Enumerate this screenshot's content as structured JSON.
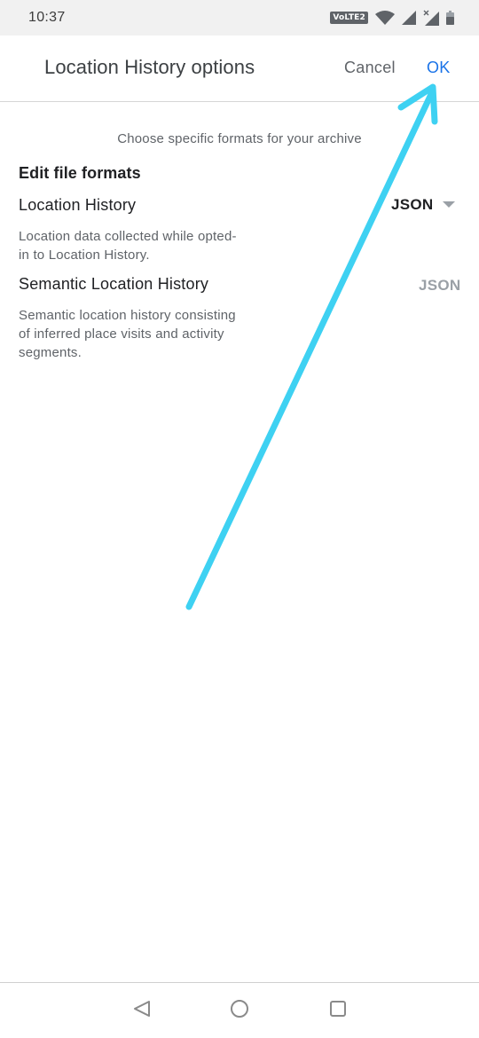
{
  "status_bar": {
    "time": "10:37",
    "network_badge": "VoLTE2"
  },
  "header": {
    "title": "Location History options",
    "cancel_label": "Cancel",
    "ok_label": "OK"
  },
  "main": {
    "subtitle": "Choose specific formats for your archive",
    "section_heading": "Edit file formats",
    "items": [
      {
        "title": "Location History",
        "description": "Location data collected while opted-in to Location History.",
        "format": "JSON",
        "editable": true
      },
      {
        "title": "Semantic Location History",
        "description": "Semantic location history consisting of inferred place visits and activity segments.",
        "format": "JSON",
        "editable": false
      }
    ]
  },
  "icons": {
    "wifi": "wifi-icon",
    "signal": "signal-icon",
    "battery": "battery-icon",
    "dropdown": "dropdown-triangle-icon",
    "back": "nav-back-icon",
    "home": "nav-home-icon",
    "recents": "nav-recents-icon",
    "annotation": "annotation-arrow-icon"
  },
  "colors": {
    "accent": "#1a73e8",
    "annotation_arrow": "#3ed1f2",
    "status_bar_bg": "#f1f1f1",
    "secondary_text": "#5f6368",
    "disabled_text": "#9aa0a6"
  }
}
